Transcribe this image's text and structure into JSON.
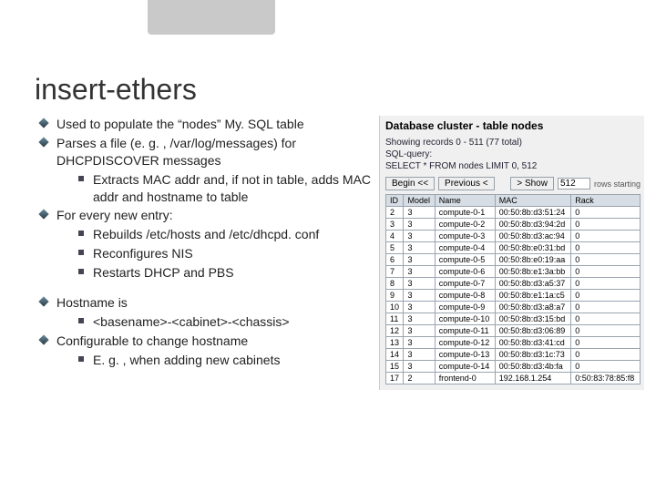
{
  "title": "insert-ethers",
  "bullets_main": [
    {
      "text": "Used to populate the “nodes” My. SQL table"
    },
    {
      "text": "Parses a file (e. g. , /var/log/messages) for DHCPDISCOVER messages",
      "sub": [
        {
          "text": "Extracts MAC addr and, if not in table, adds MAC addr and hostname to table"
        }
      ]
    },
    {
      "text": "For every new entry:",
      "sub": [
        {
          "text": "Rebuilds /etc/hosts and /etc/dhcpd. conf"
        },
        {
          "text": "Reconfigures NIS"
        },
        {
          "text": "Restarts DHCP and PBS"
        }
      ]
    }
  ],
  "bullets_secondary": [
    {
      "text": "Hostname is",
      "sub": [
        {
          "text": "<basename>-<cabinet>-<chassis>"
        }
      ]
    },
    {
      "text": "Configurable to change hostname",
      "sub": [
        {
          "text": "E. g. , when adding new cabinets"
        }
      ]
    }
  ],
  "db": {
    "heading": "Database cluster - table nodes",
    "meta1": "Showing records 0 - 511 (77 total)",
    "meta2": "SQL-query:",
    "meta3": "SELECT * FROM nodes LIMIT 0, 512",
    "nav": {
      "begin": "Begin <<",
      "prev": "Previous <",
      "show": "> Show",
      "value": "512",
      "rowstart": "rows starting"
    },
    "columns": [
      "ID",
      "Model",
      "Name",
      "MAC",
      "Rack"
    ],
    "rows": [
      [
        "2",
        "3",
        "compute-0-1",
        "00:50:8b:d3:51:24",
        "0"
      ],
      [
        "3",
        "3",
        "compute-0-2",
        "00:50:8b:d3:94:2d",
        "0"
      ],
      [
        "4",
        "3",
        "compute-0-3",
        "00:50:8b:d3:ac:94",
        "0"
      ],
      [
        "5",
        "3",
        "compute-0-4",
        "00:50:8b:e0:31:bd",
        "0"
      ],
      [
        "6",
        "3",
        "compute-0-5",
        "00:50:8b:e0:19:aa",
        "0"
      ],
      [
        "7",
        "3",
        "compute-0-6",
        "00:50:8b:e1:3a:bb",
        "0"
      ],
      [
        "8",
        "3",
        "compute-0-7",
        "00:50:8b:d3:a5:37",
        "0"
      ],
      [
        "9",
        "3",
        "compute-0-8",
        "00:50:8b:e1:1a:c5",
        "0"
      ],
      [
        "10",
        "3",
        "compute-0-9",
        "00:50:8b:d3:a8:a7",
        "0"
      ],
      [
        "11",
        "3",
        "compute-0-10",
        "00:50:8b:d3:15:bd",
        "0"
      ],
      [
        "12",
        "3",
        "compute-0-11",
        "00:50:8b:d3:06:89",
        "0"
      ],
      [
        "13",
        "3",
        "compute-0-12",
        "00:50:8b:d3:41:cd",
        "0"
      ],
      [
        "14",
        "3",
        "compute-0-13",
        "00:50:8b:d3:1c:73",
        "0"
      ],
      [
        "15",
        "3",
        "compute-0-14",
        "00:50:8b:d3:4b:fa",
        "0"
      ],
      [
        "17",
        "2",
        "frontend-0",
        "192.168.1.254",
        "0:50:83:78:85:f8"
      ]
    ]
  }
}
